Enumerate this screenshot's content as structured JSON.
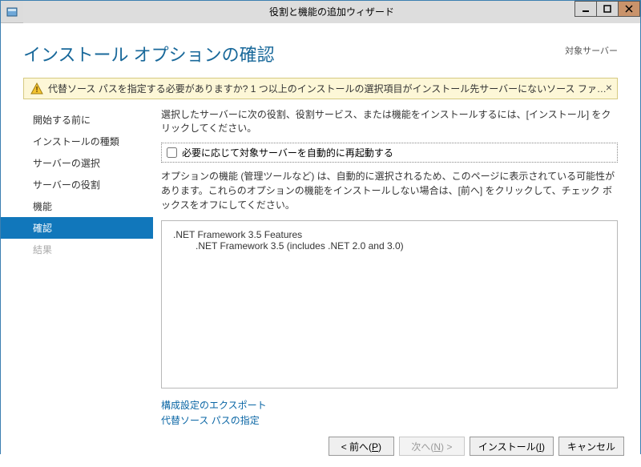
{
  "window": {
    "title": "役割と機能の追加ウィザード"
  },
  "header": {
    "page_title": "インストール オプションの確認",
    "target_label": "対象サーバー"
  },
  "warning": {
    "text": "代替ソース パスを指定する必要がありますか? 1 つ以上のインストールの選択項目がインストール先サーバーにないソース ファイルです。サーバ…"
  },
  "sidebar": {
    "items": [
      {
        "label": "開始する前に"
      },
      {
        "label": "インストールの種類"
      },
      {
        "label": "サーバーの選択"
      },
      {
        "label": "サーバーの役割"
      },
      {
        "label": "機能"
      },
      {
        "label": "確認"
      },
      {
        "label": "結果"
      }
    ]
  },
  "main": {
    "instruction": "選択したサーバーに次の役割、役割サービス、または機能をインストールするには、[インストール] をクリックしてください。",
    "checkbox_label": "必要に応じて対象サーバーを自動的に再起動する",
    "note": "オプションの機能 (管理ツールなど) は、自動的に選択されるため、このページに表示されている可能性があります。これらのオプションの機能をインストールしない場合は、[前へ] をクリックして、チェック ボックスをオフにしてください。",
    "features": {
      "root": ".NET Framework 3.5 Features",
      "child": ".NET Framework 3.5 (includes .NET 2.0 and 3.0)"
    },
    "links": {
      "export": "構成設定のエクスポート",
      "alt_source": "代替ソース パスの指定"
    }
  },
  "footer": {
    "prev": "< 前へ(P)",
    "next": "次へ(N) >",
    "install": "インストール(I)",
    "cancel": "キャンセル"
  }
}
